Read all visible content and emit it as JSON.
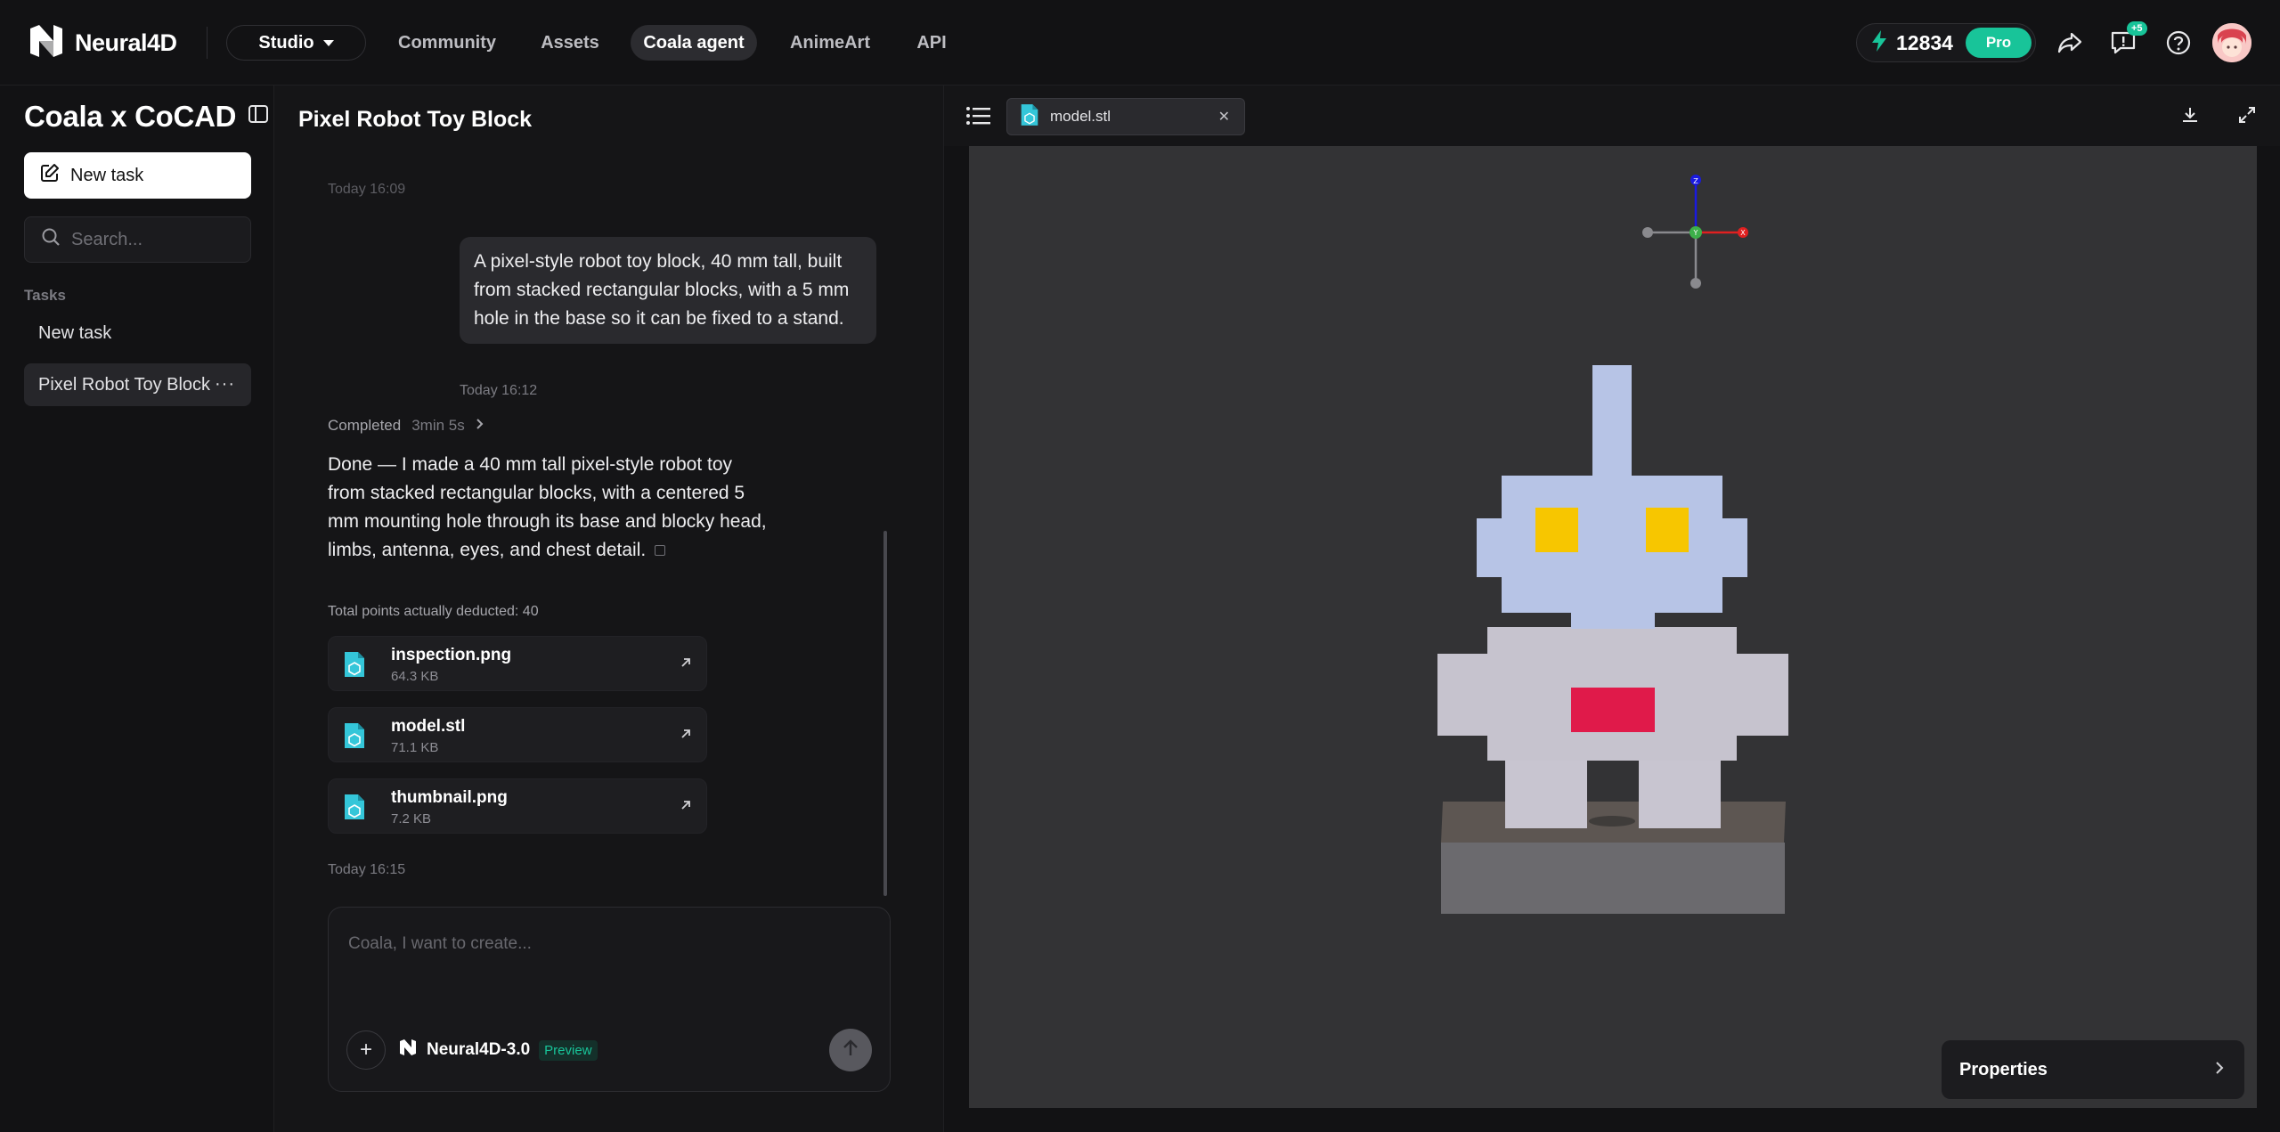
{
  "brand": {
    "name": "Neural4D"
  },
  "nav": {
    "studio_label": "Studio",
    "items": [
      {
        "label": "Community"
      },
      {
        "label": "Assets"
      },
      {
        "label": "Coala agent"
      },
      {
        "label": "AnimeArt"
      },
      {
        "label": "API"
      }
    ]
  },
  "account": {
    "credits": "12834",
    "plan": "Pro",
    "notification_badge": "+5"
  },
  "sidebar": {
    "title": "Coala x CoCAD",
    "new_task_label": "New task",
    "search_placeholder": "Search...",
    "section_label": "Tasks",
    "tasks": [
      {
        "label": "New task"
      },
      {
        "label": "Pixel Robot Toy Block",
        "more": "···"
      }
    ]
  },
  "chat": {
    "title": "Pixel Robot Toy Block",
    "faded_timestamp": "Today 16:09",
    "user_message": "A pixel-style robot toy block, 40 mm tall, built from stacked rectangular blocks, with a 5 mm hole in the base so it can be fixed to a stand.",
    "user_timestamp": "Today 16:12",
    "status": "Completed",
    "duration": "3min 5s",
    "reply": "Done — I made a 40 mm tall pixel-style robot toy from stacked rectangular blocks, with a centered 5 mm mounting hole through its base and blocky head, limbs, antenna, eyes, and chest detail.",
    "points_line": "Total points actually deducted: 40",
    "files": [
      {
        "name": "inspection.png",
        "size": "64.3 KB"
      },
      {
        "name": "model.stl",
        "size": "71.1 KB"
      },
      {
        "name": "thumbnail.png",
        "size": "7.2 KB"
      }
    ],
    "reply_timestamp": "Today 16:15"
  },
  "composer": {
    "placeholder": "Coala, I want to create...",
    "model_name": "Neural4D-3.0",
    "model_tag": "Preview"
  },
  "viewer": {
    "open_file": "model.stl",
    "properties_label": "Properties",
    "axes": {
      "x": "X",
      "y": "Y",
      "z": "Z"
    }
  },
  "colors": {
    "accent": "#18c499",
    "robot_head": "#b7c4e6",
    "robot_body": "#c6c3ce",
    "robot_eyes": "#f7c600",
    "robot_chest": "#e01a4a",
    "base_top": "#5d5652",
    "base_front": "#6b6a6e",
    "canvas_bg": "#333335"
  }
}
